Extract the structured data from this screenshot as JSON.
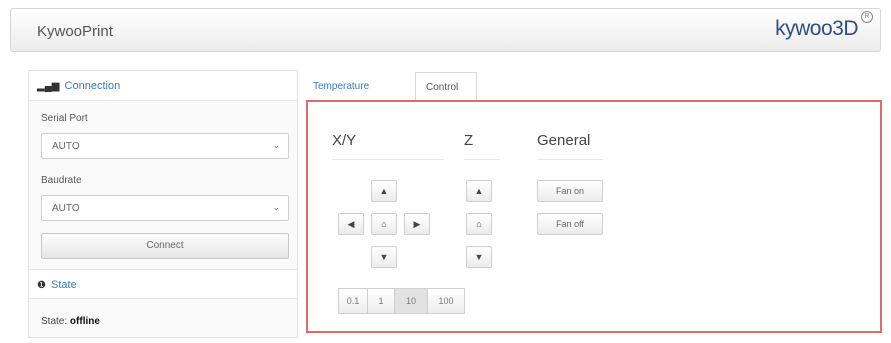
{
  "header": {
    "app_title": "KywooPrint",
    "brand": "kywoo3D",
    "brand_mark": "R"
  },
  "sidebar": {
    "connection": {
      "icon": "signal-icon",
      "title": "Connection",
      "serial_port_label": "Serial Port",
      "serial_port_value": "AUTO",
      "baudrate_label": "Baudrate",
      "baudrate_value": "AUTO",
      "connect_label": "Connect"
    },
    "state": {
      "icon": "info-circle-icon",
      "title": "State",
      "state_label": "State:",
      "state_value": "offline"
    }
  },
  "tabs": [
    {
      "label": "Temperature",
      "active": false
    },
    {
      "label": "Control",
      "active": true
    }
  ],
  "control": {
    "xy_title": "X/Y",
    "z_title": "Z",
    "general_title": "General",
    "fan_on_label": "Fan on",
    "fan_off_label": "Fan off",
    "jog_glyphs": {
      "up": "▲",
      "down": "▼",
      "left": "◀",
      "right": "▶",
      "home": "⌂"
    },
    "step_sizes": [
      "0.1",
      "1",
      "10",
      "100"
    ],
    "active_step": "10"
  },
  "colors": {
    "accent": "#3a7bc0",
    "highlight_border": "#e06a6a",
    "brand": "#2f4f7f"
  }
}
